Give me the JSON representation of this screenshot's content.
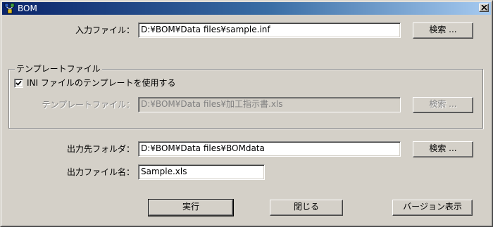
{
  "window": {
    "title": "BOM",
    "app_icon": "bom-app-icon",
    "close_icon": "close-icon"
  },
  "input": {
    "label": "入力ファイル：",
    "value": "D:¥BOM¥Data files¥sample.inf",
    "browse_label": "検索 ..."
  },
  "template_group": {
    "legend": "テンプレートファイル",
    "use_ini_checkbox_label": "INI ファイルのテンプレートを使用する",
    "use_ini_checked": true,
    "file_label": "テンプレートファイル：",
    "file_value": "D:¥BOM¥Data files¥加工指示書.xls",
    "browse_label": "検索 ..."
  },
  "output": {
    "folder_label": "出力先フォルダ：",
    "folder_value": "D:¥BOM¥Data files¥BOMdata",
    "browse_label": "検索 ...",
    "filename_label": "出力ファイル名：",
    "filename_value": "Sample.xls"
  },
  "actions": {
    "run_label": "実行",
    "close_label": "閉じる",
    "version_label": "バージョン表示"
  },
  "colors": {
    "face": "#d4d0c8",
    "title_start": "#0a246a",
    "title_end": "#a6caf0",
    "disabled_text": "#808080"
  }
}
